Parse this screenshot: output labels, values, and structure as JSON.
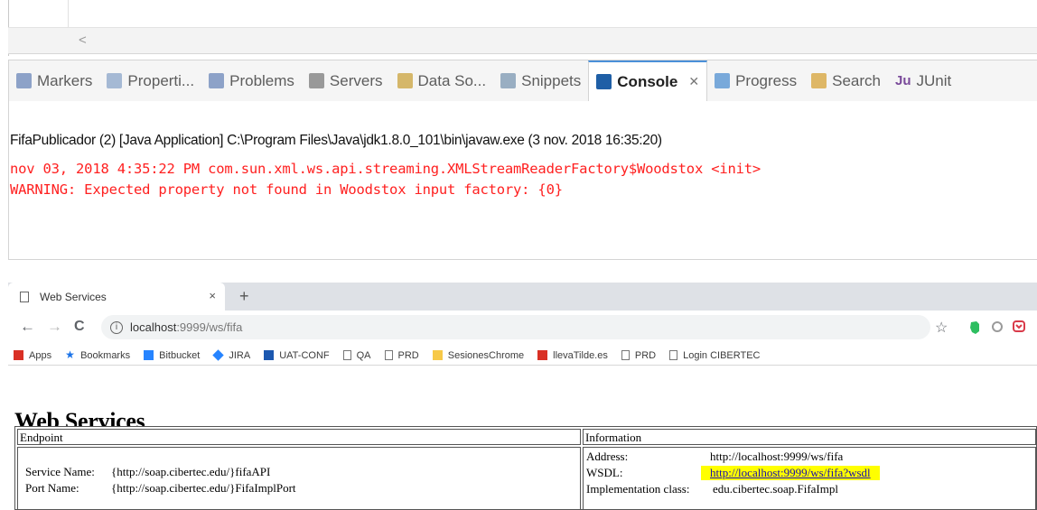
{
  "eclipse": {
    "scroll_left_arrow": "<",
    "tabs": [
      {
        "label": "Markers",
        "icon": "markers-icon",
        "color": "#6a86b8"
      },
      {
        "label": "Properti...",
        "icon": "properties-icon",
        "color": "#8aa4c8"
      },
      {
        "label": "Problems",
        "icon": "problems-icon",
        "color": "#6a86b8"
      },
      {
        "label": "Servers",
        "icon": "servers-icon",
        "color": "#7a7a7a"
      },
      {
        "label": "Data So...",
        "icon": "data-source-icon",
        "color": "#c9a13b"
      },
      {
        "label": "Snippets",
        "icon": "snippets-icon",
        "color": "#7a96b0"
      },
      {
        "label": "Console",
        "icon": "console-icon",
        "color": "#1f5fa6",
        "active": true,
        "close": "✕"
      },
      {
        "label": "Progress",
        "icon": "progress-icon",
        "color": "#4f8fd0"
      },
      {
        "label": "Search",
        "icon": "search-icon",
        "color": "#d6a236"
      },
      {
        "label": "JUnit",
        "prefix": "Ju",
        "icon": "junit-icon",
        "color": "#7a4a9a"
      }
    ],
    "console": {
      "title": "FifaPublicador (2) [Java Application] C:\\Program Files\\Java\\jdk1.8.0_101\\bin\\javaw.exe (3 nov. 2018 16:35:20)",
      "lines": [
        "nov 03, 2018 4:35:22 PM com.sun.xml.ws.api.streaming.XMLStreamReaderFactory$Woodstox <init>",
        "WARNING: Expected property not found in Woodstox input factory: {0}"
      ],
      "error_color": "#ff2020"
    }
  },
  "browser": {
    "tab": {
      "title": "Web Services",
      "close": "×",
      "new_tab": "+"
    },
    "nav": {
      "back": "←",
      "forward": "→",
      "reload": "C"
    },
    "address": {
      "host": "localhost",
      "path": ":9999/ws/fifa"
    },
    "toolbar": {
      "star": "☆"
    },
    "bookmarks": [
      {
        "label": "Apps",
        "icon": "apps-icon",
        "color": "#d93025"
      },
      {
        "label": "Bookmarks",
        "icon": "star-icon",
        "color": "#1a73e8"
      },
      {
        "label": "Bitbucket",
        "icon": "bitbucket-icon",
        "color": "#2684ff"
      },
      {
        "label": "JIRA",
        "icon": "jira-icon",
        "color": "#2684ff"
      },
      {
        "label": "UAT-CONF",
        "icon": "confluence-icon",
        "color": "#1c58b0"
      },
      {
        "label": "QA",
        "icon": "page-icon",
        "color": "#777777"
      },
      {
        "label": "PRD",
        "icon": "page-icon",
        "color": "#777777"
      },
      {
        "label": "SesionesChrome",
        "icon": "folder-icon",
        "color": "#f7c948"
      },
      {
        "label": "llevaTilde.es",
        "icon": "llevatilde-icon",
        "color": "#d93025"
      },
      {
        "label": "PRD",
        "icon": "page-icon",
        "color": "#777777"
      },
      {
        "label": "Login CIBERTEC",
        "icon": "page-icon",
        "color": "#777777"
      }
    ],
    "page": {
      "heading": "Web Services",
      "headers": {
        "endpoint": "Endpoint",
        "information": "Information"
      },
      "service_name_label": "Service Name:",
      "service_name_value": "{http://soap.cibertec.edu/}fifaAPI",
      "port_name_label": "Port Name:",
      "port_name_value": "{http://soap.cibertec.edu/}FifaImplPort",
      "address_label": "Address:",
      "address_value": "http://localhost:9999/ws/fifa",
      "wsdl_label": "WSDL:",
      "wsdl_value": "http://localhost:9999/ws/fifa?wsdl",
      "impl_label": "Implementation class:",
      "impl_value": "edu.cibertec.soap.FifaImpl"
    }
  }
}
